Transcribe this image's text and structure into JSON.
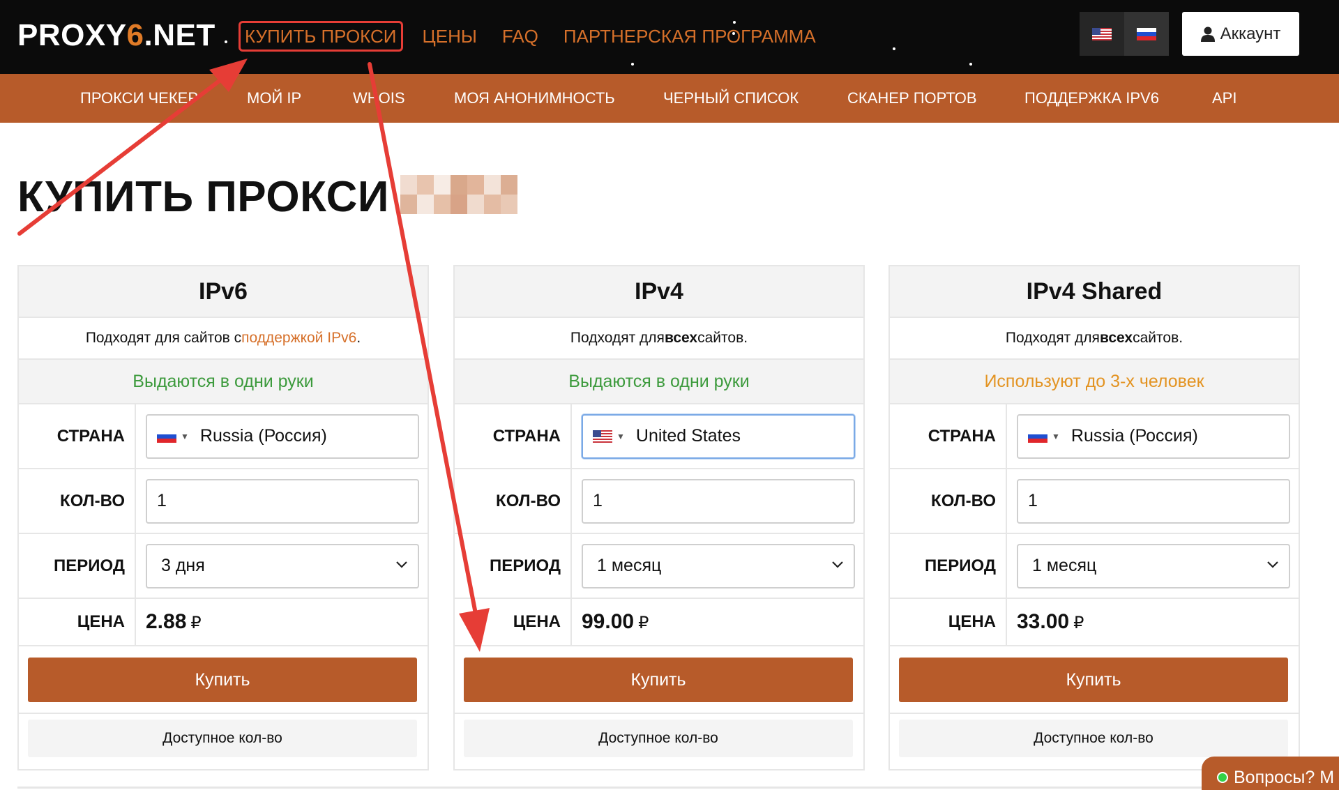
{
  "header": {
    "logo_prefix": "PROXY",
    "logo_six": "6",
    "logo_suffix": ".NET",
    "nav": [
      "КУПИТЬ ПРОКСИ",
      "ЦЕНЫ",
      "FAQ",
      "ПАРТНЕРСКАЯ ПРОГРАММА"
    ],
    "account_label": "Аккаунт",
    "languages": [
      "us-flag-icon",
      "ru-flag-icon"
    ]
  },
  "subnav": [
    "ПРОКСИ ЧЕКЕР",
    "МОЙ IP",
    "WHOIS",
    "МОЯ АНОНИМНОСТЬ",
    "ЧЕРНЫЙ СПИСОК",
    "СКАНЕР ПОРТОВ",
    "ПОДДЕРЖКА IPV6",
    "API"
  ],
  "page": {
    "title": "КУПИТЬ ПРОКСИ /"
  },
  "labels": {
    "country": "СТРАНА",
    "quantity": "КОЛ-ВО",
    "period": "ПЕРИОД",
    "price": "ЦЕНА",
    "buy": "Купить",
    "available": "Доступное кол-во",
    "currency": "₽"
  },
  "cards": [
    {
      "title": "IPv6",
      "subtitle_before": "Подходят для сайтов с ",
      "subtitle_highlight": "поддержкой IPv6",
      "subtitle_after": ".",
      "note": "Выдаются в одни руки",
      "note_color": "#3c9a3c",
      "country": "Russia (Россия)",
      "country_flag": "ru-flag-icon",
      "quantity": "1",
      "period": "3 дня",
      "price": "2.88"
    },
    {
      "title": "IPv4",
      "subtitle_before": "Подходят для ",
      "subtitle_bold": "всех",
      "subtitle_after": " сайтов.",
      "note": "Выдаются в одни руки",
      "note_color": "#3c9a3c",
      "country": "United States",
      "country_flag": "us-flag-icon",
      "quantity": "1",
      "period": "1 месяц",
      "price": "99.00"
    },
    {
      "title": "IPv4 Shared",
      "subtitle_before": "Подходят для ",
      "subtitle_bold": "всех",
      "subtitle_after": " сайтов.",
      "note": "Используют до 3-х человек",
      "note_color": "#e39321",
      "country": "Russia (Россия)",
      "country_flag": "ru-flag-icon",
      "quantity": "1",
      "period": "1 месяц",
      "price": "33.00"
    }
  ],
  "chat": {
    "label": "Вопросы? М"
  },
  "colors": {
    "accent": "#d6702a",
    "subnav_bg": "#b75b2a",
    "button_bg": "#b75b2a",
    "annotation_red": "#e63d36"
  }
}
